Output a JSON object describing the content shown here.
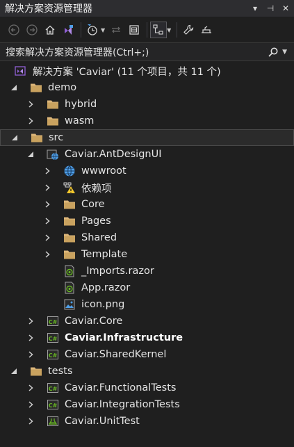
{
  "window": {
    "title": "解决方案资源管理器",
    "controls": [
      "▾",
      "⊣",
      "✕"
    ]
  },
  "search": {
    "placeholder": "搜索解决方案资源管理器(Ctrl+;)"
  },
  "solution": {
    "label": "解决方案 'Caviar' (11 个项目，共 11 个)"
  },
  "tree": [
    {
      "label": "demo",
      "icon": "folder-icon",
      "expander": "expanded"
    },
    {
      "label": "hybrid",
      "icon": "folder-icon",
      "expander": "collapsed"
    },
    {
      "label": "wasm",
      "icon": "folder-icon",
      "expander": "collapsed"
    },
    {
      "label": "src",
      "icon": "folder-icon",
      "expander": "expanded"
    },
    {
      "label": "Caviar.AntDesignUI",
      "icon": "web-project-icon",
      "expander": "expanded"
    },
    {
      "label": "wwwroot",
      "icon": "globe-icon",
      "expander": "collapsed"
    },
    {
      "label": "依赖项",
      "icon": "dependencies-warning-icon",
      "expander": "collapsed"
    },
    {
      "label": "Core",
      "icon": "folder-icon",
      "expander": "collapsed"
    },
    {
      "label": "Pages",
      "icon": "folder-icon",
      "expander": "collapsed"
    },
    {
      "label": "Shared",
      "icon": "folder-icon",
      "expander": "collapsed"
    },
    {
      "label": "Template",
      "icon": "folder-icon",
      "expander": "collapsed"
    },
    {
      "label": "_Imports.razor",
      "icon": "razor-file-icon",
      "expander": "none"
    },
    {
      "label": "App.razor",
      "icon": "razor-file-icon",
      "expander": "none"
    },
    {
      "label": "icon.png",
      "icon": "image-file-icon",
      "expander": "none"
    },
    {
      "label": "Caviar.Core",
      "icon": "csharp-project-icon",
      "expander": "collapsed"
    },
    {
      "label": "Caviar.Infrastructure",
      "icon": "csharp-project-icon",
      "expander": "collapsed"
    },
    {
      "label": "Caviar.SharedKernel",
      "icon": "csharp-project-icon",
      "expander": "collapsed"
    },
    {
      "label": "tests",
      "icon": "folder-icon",
      "expander": "expanded"
    },
    {
      "label": "Caviar.FunctionalTests",
      "icon": "csharp-project-icon",
      "expander": "collapsed"
    },
    {
      "label": "Caviar.IntegrationTests",
      "icon": "csharp-project-icon",
      "expander": "collapsed"
    },
    {
      "label": "Caviar.UnitTest",
      "icon": "test-project-icon",
      "expander": "collapsed"
    }
  ],
  "colors": {
    "background": "#1f1f1f",
    "folder": "#dcb67a",
    "csharp": "#68b723",
    "web": "#4f9fe8",
    "accent_vs": "#8f5fd4"
  }
}
